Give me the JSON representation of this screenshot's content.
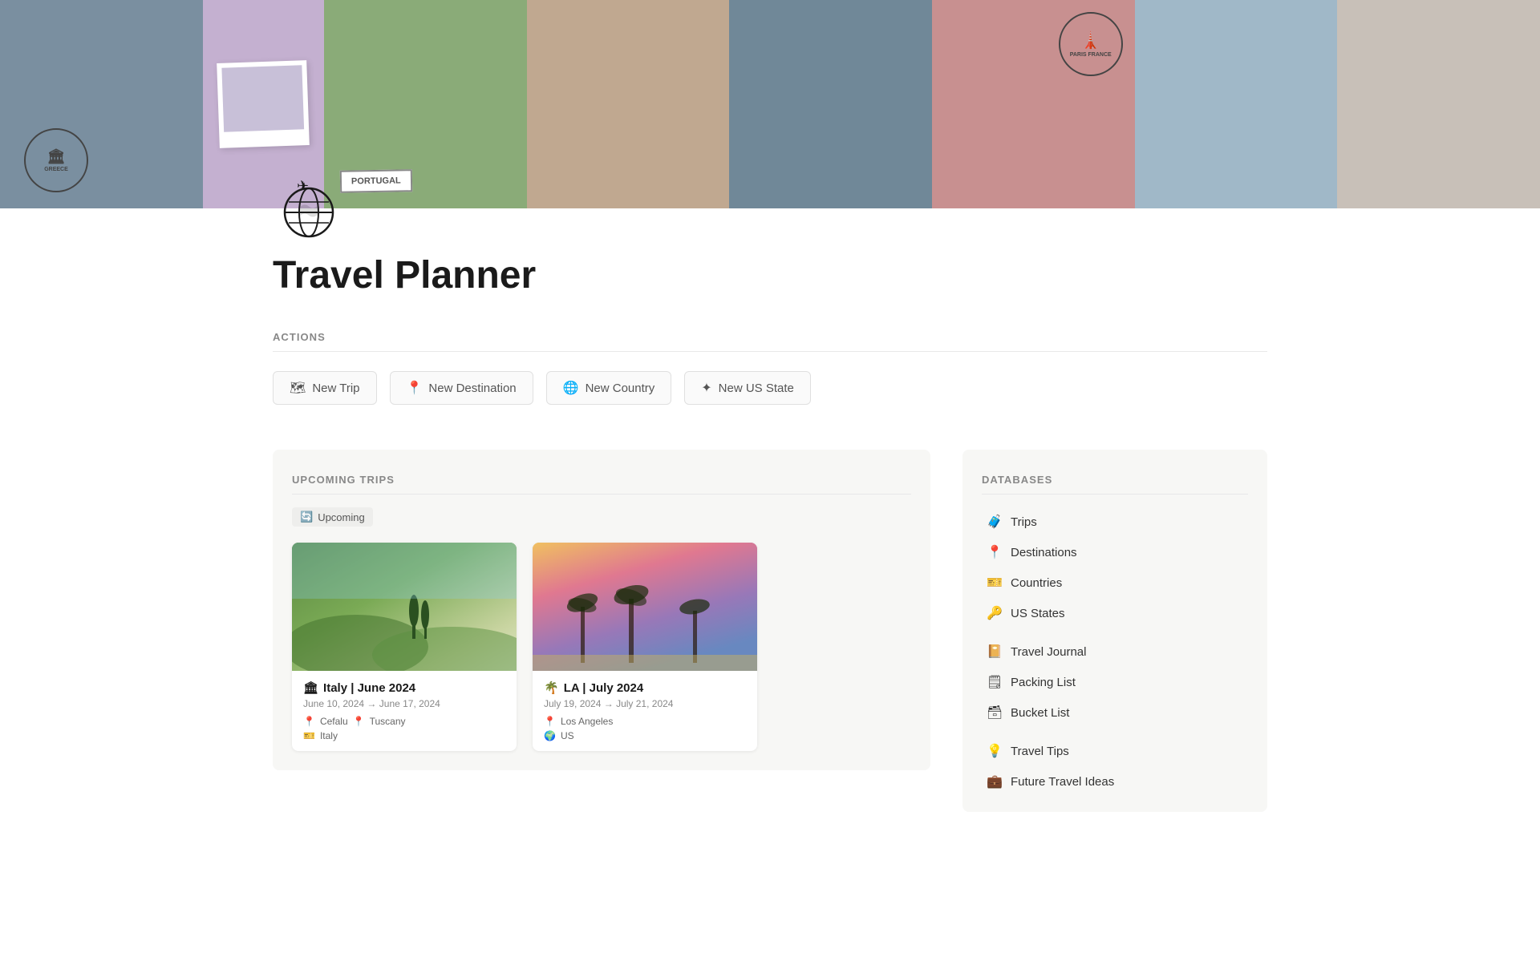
{
  "page": {
    "title": "Travel Planner",
    "icon": "🌍"
  },
  "banner": {
    "photos": [
      {
        "label": "city-waterfront",
        "color": "#8a9db5"
      },
      {
        "label": "purple-bg",
        "color": "#c4b8d4"
      },
      {
        "label": "coastal-cliffs",
        "color": "#b0c8b0"
      },
      {
        "label": "architecture",
        "color": "#c8b8a0"
      },
      {
        "label": "barcelona",
        "color": "#9ab0c8"
      },
      {
        "label": "palm-trees",
        "color": "#d4c0c0"
      },
      {
        "label": "sky-gradient",
        "color": "#c0c8d4"
      },
      {
        "label": "white-buildings",
        "color": "#d8d0c8"
      }
    ],
    "stamps": [
      {
        "text": "GREECE",
        "sub": ""
      },
      {
        "text": "PORTUGAL",
        "sub": ""
      },
      {
        "text": "PARIS FRANCE",
        "sub": "EIFFEL TOWER"
      }
    ]
  },
  "actions": {
    "section_label": "ACTIONS",
    "buttons": [
      {
        "id": "new-trip",
        "icon": "🗺",
        "label": "New Trip"
      },
      {
        "id": "new-destination",
        "icon": "📍",
        "label": "New Destination"
      },
      {
        "id": "new-country",
        "icon": "🌐",
        "label": "New Country"
      },
      {
        "id": "new-us-state",
        "icon": "✦",
        "label": "New US State"
      }
    ]
  },
  "upcoming_trips": {
    "section_label": "UPCOMING TRIPS",
    "filter_label": "Upcoming",
    "cards": [
      {
        "id": "italy-trip",
        "emoji": "🏛",
        "title": "Italy | June 2024",
        "date_start": "June 10, 2024",
        "date_end": "June 17, 2024",
        "destinations": [
          "Cefalu",
          "Tuscany"
        ],
        "country": "Italy",
        "image_type": "italy"
      },
      {
        "id": "la-trip",
        "emoji": "🌴",
        "title": "LA | July 2024",
        "date_start": "July 19, 2024",
        "date_end": "July 21, 2024",
        "destinations": [
          "Los Angeles"
        ],
        "country": "US",
        "image_type": "la"
      }
    ]
  },
  "databases": {
    "section_label": "DATABASES",
    "primary": [
      {
        "id": "trips",
        "icon": "🧳",
        "label": "Trips"
      },
      {
        "id": "destinations",
        "icon": "📍",
        "label": "Destinations"
      },
      {
        "id": "countries",
        "icon": "🎫",
        "label": "Countries"
      },
      {
        "id": "us-states",
        "icon": "🔑",
        "label": "US States"
      }
    ],
    "secondary": [
      {
        "id": "travel-journal",
        "icon": "📔",
        "label": "Travel Journal"
      },
      {
        "id": "packing-list",
        "icon": "🗒",
        "label": "Packing List"
      },
      {
        "id": "bucket-list",
        "icon": "🗃",
        "label": "Bucket List"
      }
    ],
    "tertiary": [
      {
        "id": "travel-tips",
        "icon": "💡",
        "label": "Travel Tips"
      },
      {
        "id": "future-travel-ideas",
        "icon": "💼",
        "label": "Future Travel Ideas"
      }
    ]
  }
}
